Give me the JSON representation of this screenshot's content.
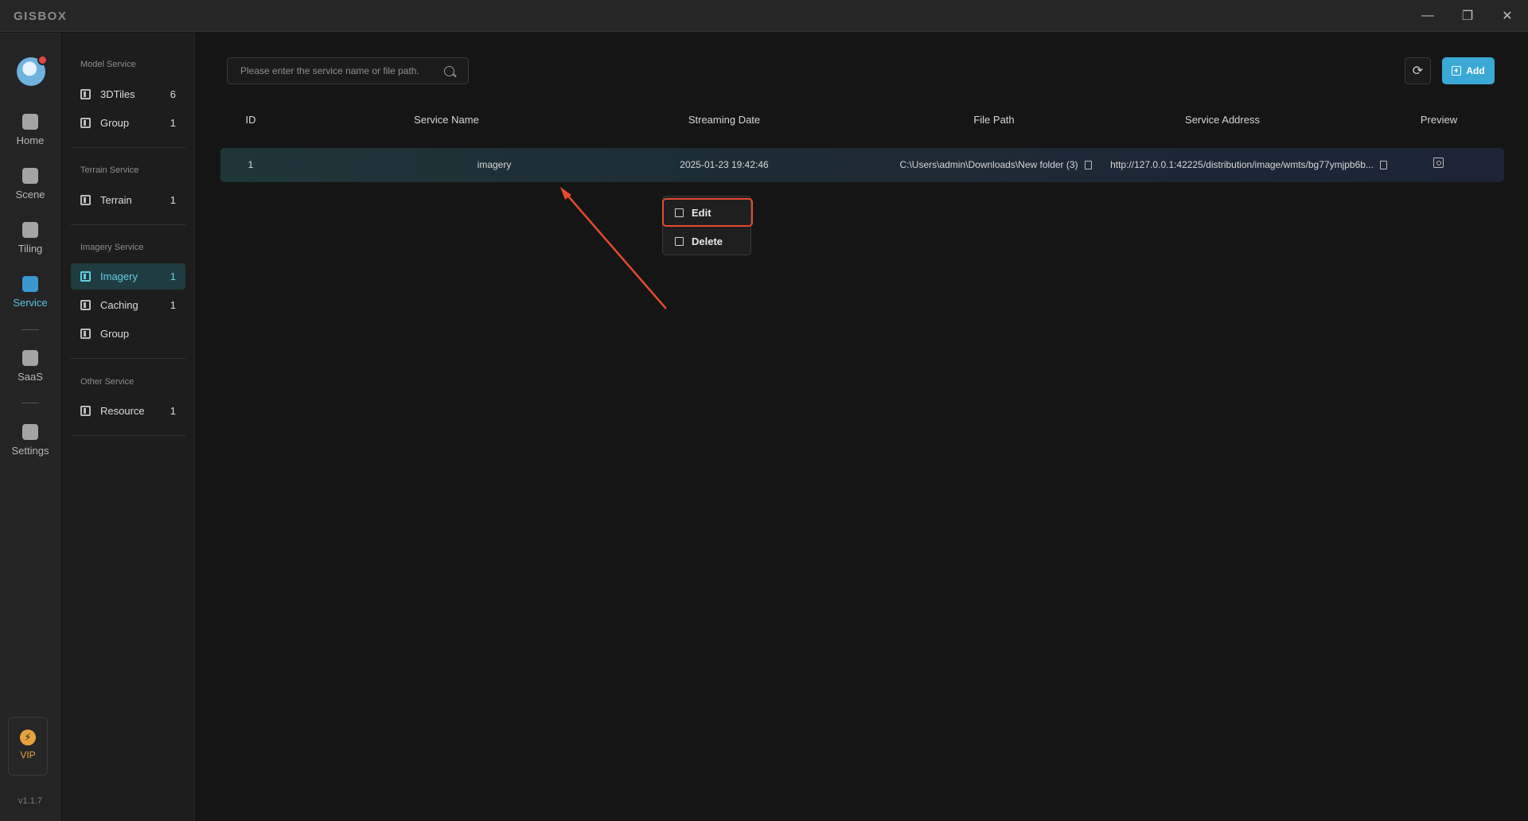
{
  "app": {
    "logo": "GISBOX",
    "version": "v1.1.7"
  },
  "window_controls": {
    "minimize": "—",
    "maximize": "❐",
    "close": "✕"
  },
  "rail": {
    "items": [
      {
        "label": "Home",
        "icon": "home-icon"
      },
      {
        "label": "Scene",
        "icon": "cube-icon"
      },
      {
        "label": "Tiling",
        "icon": "tiling-icon"
      },
      {
        "label": "Service",
        "icon": "service-icon"
      },
      {
        "label": "SaaS",
        "icon": "lock-icon"
      },
      {
        "label": "Settings",
        "icon": "gear-icon"
      }
    ],
    "vip_label": "VIP",
    "vip_icon": "⚡"
  },
  "sidebar": {
    "groups": [
      {
        "title": "Model Service",
        "items": [
          {
            "label": "3DTiles",
            "count": "6"
          },
          {
            "label": "Group",
            "count": "1"
          }
        ]
      },
      {
        "title": "Terrain Service",
        "items": [
          {
            "label": "Terrain",
            "count": "1"
          }
        ]
      },
      {
        "title": "Imagery Service",
        "items": [
          {
            "label": "Imagery",
            "count": "1"
          },
          {
            "label": "Caching",
            "count": "1"
          },
          {
            "label": "Group",
            "count": ""
          }
        ]
      },
      {
        "title": "Other Service",
        "items": [
          {
            "label": "Resource",
            "count": "1"
          }
        ]
      }
    ]
  },
  "search": {
    "placeholder": "Please enter the service name or file path."
  },
  "toolbar": {
    "refresh_icon": "⟳",
    "add_label": "Add"
  },
  "table": {
    "headers": [
      "ID",
      "Service Name",
      "Streaming Date",
      "File Path",
      "Service Address",
      "Preview"
    ],
    "rows": [
      {
        "id": "1",
        "service_name": "imagery",
        "streaming_date": "2025-01-23 19:42:46",
        "file_path": "C:\\Users\\admin\\Downloads\\New folder (3)",
        "service_address": "http://127.0.0.1:42225/distribution/image/wmts/bg77ymjpb6b..."
      }
    ]
  },
  "context_menu": {
    "edit_label": "Edit",
    "delete_label": "Delete"
  },
  "colors": {
    "accent": "#3ba9d6",
    "highlight": "#e64a2e"
  }
}
